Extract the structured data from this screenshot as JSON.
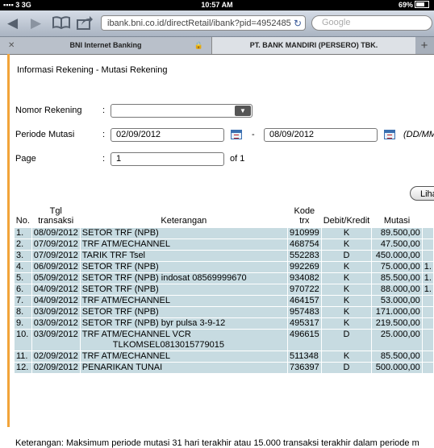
{
  "status_bar": {
    "signal": "3G",
    "carrier": "3",
    "time": "10:57 AM",
    "battery": "69%"
  },
  "browser": {
    "url": "ibank.bni.co.id/directRetail/ibank?pid=4952485",
    "search_placeholder": "Google",
    "tabs": [
      {
        "label": "BNI Internet Banking"
      },
      {
        "label": "PT. BANK MANDIRI (PERSERO) TBK."
      }
    ]
  },
  "page": {
    "title": "Informasi Rekening - Mutasi Rekening",
    "form": {
      "account_label": "Nomor Rekening",
      "account_value": "",
      "period_label": "Periode Mutasi",
      "date_from": "02/09/2012",
      "date_sep": "-",
      "date_to": "08/09/2012",
      "date_format": "(DD/MM",
      "page_label": "Page",
      "page_value": "1",
      "page_of": "of 1",
      "colon": ":"
    },
    "view_button": "Liha",
    "table": {
      "headers": {
        "no": "No.",
        "date": "Tgl transaksi",
        "desc": "Keterangan",
        "code": "Kode trx",
        "dc": "Debit/Kredit",
        "amount": "Mutasi"
      },
      "rows": [
        {
          "no": "1.",
          "date": "08/09/2012",
          "desc": "SETOR TRF (NPB)",
          "code": "910999",
          "dc": "K",
          "amount": "89.500,00",
          "extra": ""
        },
        {
          "no": "2.",
          "date": "07/09/2012",
          "desc": "TRF ATM/ECHANNEL",
          "code": "468754",
          "dc": "K",
          "amount": "47.500,00",
          "extra": ""
        },
        {
          "no": "3.",
          "date": "07/09/2012",
          "desc": "TARIK TRF   Tsel",
          "code": "552283",
          "dc": "D",
          "amount": "450.000,00",
          "extra": ""
        },
        {
          "no": "4.",
          "date": "06/09/2012",
          "desc": "SETOR TRF (NPB)",
          "code": "992269",
          "dc": "K",
          "amount": "75.000,00",
          "extra": "1."
        },
        {
          "no": "5.",
          "date": "05/09/2012",
          "desc": "SETOR TRF (NPB)   indosat 08569999670",
          "code": "934082",
          "dc": "K",
          "amount": "85.500,00",
          "extra": "1."
        },
        {
          "no": "6.",
          "date": "04/09/2012",
          "desc": "SETOR TRF (NPB)",
          "code": "970722",
          "dc": "K",
          "amount": "88.000,00",
          "extra": "1."
        },
        {
          "no": "7.",
          "date": "04/09/2012",
          "desc": "TRF ATM/ECHANNEL",
          "code": "464157",
          "dc": "K",
          "amount": "53.000,00",
          "extra": ""
        },
        {
          "no": "8.",
          "date": "03/09/2012",
          "desc": "SETOR TRF (NPB)",
          "code": "957483",
          "dc": "K",
          "amount": "171.000,00",
          "extra": ""
        },
        {
          "no": "9.",
          "date": "03/09/2012",
          "desc": "SETOR TRF (NPB)   byr pulsa 3-9-12",
          "code": "495317",
          "dc": "K",
          "amount": "219.500,00",
          "extra": ""
        },
        {
          "no": "10.",
          "date": "03/09/2012",
          "desc": "TRF ATM/ECHANNEL   VCR",
          "desc2": "TLKOMSEL0813015779015",
          "code": "496615",
          "dc": "D",
          "amount": "25.000,00",
          "extra": ""
        },
        {
          "no": "11.",
          "date": "02/09/2012",
          "desc": "TRF ATM/ECHANNEL",
          "code": "511348",
          "dc": "K",
          "amount": "85.500,00",
          "extra": ""
        },
        {
          "no": "12.",
          "date": "02/09/2012",
          "desc": "PENARIKAN TUNAI",
          "code": "736397",
          "dc": "D",
          "amount": "500.000,00",
          "extra": ""
        }
      ]
    },
    "footer_note": "Keterangan: Maksimum periode mutasi 31 hari terakhir atau 15.000 transaksi terakhir dalam periode m"
  },
  "colors": {
    "row_bg": "#c7dbe1",
    "accent_line": "#f2a43a"
  }
}
